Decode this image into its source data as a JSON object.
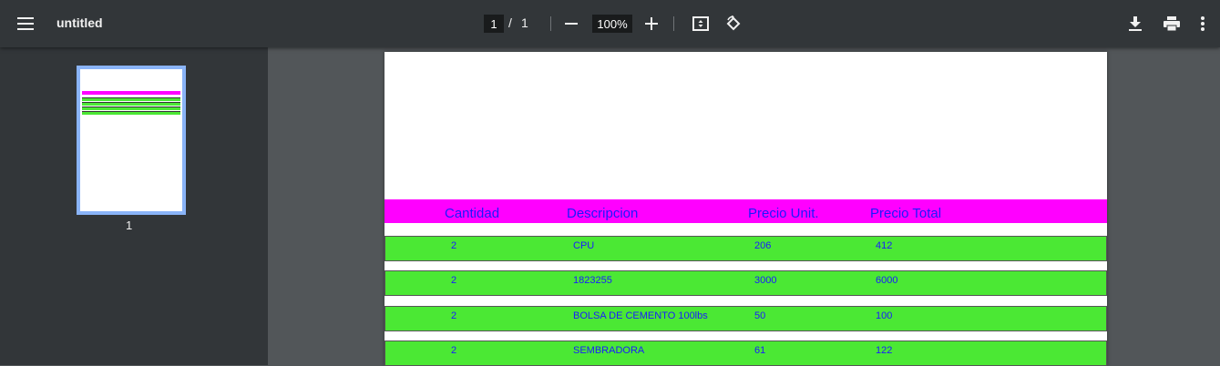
{
  "toolbar": {
    "title": "untitled",
    "page_current": "1",
    "page_separator": "/",
    "page_total": "1",
    "zoom": "100%"
  },
  "sidebar": {
    "thumbnail_label": "1"
  },
  "document": {
    "columns": [
      "Cantidad",
      "Descripcion",
      "Precio Unit.",
      "Precio Total"
    ],
    "rows": [
      [
        "2",
        "CPU",
        "206",
        "412"
      ],
      [
        "2",
        "1823255",
        "3000",
        "6000"
      ],
      [
        "2",
        "BOLSA DE CEMENTO 100lbs",
        "50",
        "100"
      ],
      [
        "2",
        "SEMBRADORA",
        "61",
        "122"
      ]
    ]
  },
  "colors": {
    "toolbar_bg": "#323639",
    "viewer_bg": "#525659",
    "header_bg": "#ff00ff",
    "row_bg": "#4be834",
    "text_color": "#1a1aff",
    "thumb_border": "#8ab4f8"
  }
}
